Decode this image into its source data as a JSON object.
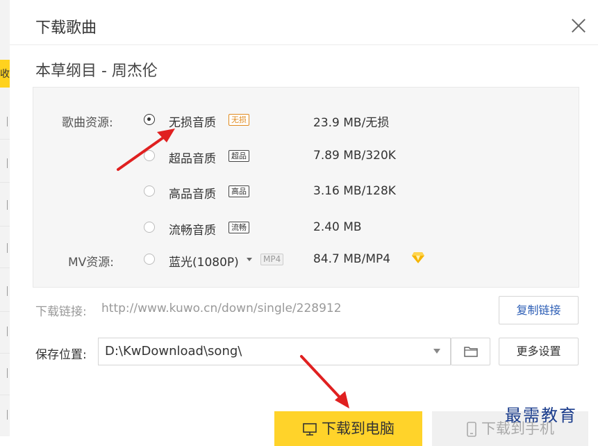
{
  "dialog": {
    "title": "下载歌曲",
    "song_name": "本草纲目 - 周杰伦"
  },
  "background": {
    "tab_text": "收"
  },
  "quality": {
    "song_source_label": "歌曲资源:",
    "mv_source_label": "MV资源:",
    "options": [
      {
        "label": "无损音质",
        "badge": "无损",
        "size": "23.9 MB/无损",
        "checked": true
      },
      {
        "label": "超品音质",
        "badge": "超品",
        "size": "7.89 MB/320K",
        "checked": false
      },
      {
        "label": "高品音质",
        "badge": "高品",
        "size": "3.16 MB/128K",
        "checked": false
      },
      {
        "label": "流畅音质",
        "badge": "流畅",
        "size": "2.40 MB",
        "checked": false
      }
    ],
    "mv": {
      "label": "蓝光(1080P)",
      "badge": "MP4",
      "size": "84.7 MB/MP4",
      "checked": false
    }
  },
  "link": {
    "label": "下载链接:",
    "url": "http://www.kuwo.cn/down/single/228912",
    "copy_button": "复制链接"
  },
  "save": {
    "label": "保存位置:",
    "path": "D:\\KwDownload\\song\\",
    "more_button": "更多设置"
  },
  "actions": {
    "download_pc": "下载到电脑",
    "download_phone": "下载到手机"
  },
  "watermark": "最需教育",
  "colors": {
    "accent_yellow": "#ffd32a",
    "lossless_badge": "#e08a1e",
    "arrow_red": "#e02020",
    "link_blue": "#2b5db5"
  }
}
